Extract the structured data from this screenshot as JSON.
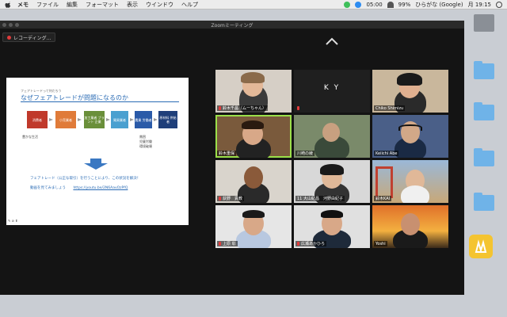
{
  "menubar": {
    "items": [
      "メモ",
      "ファイル",
      "編集",
      "フォーマット",
      "表示",
      "ウインドウ",
      "ヘルプ"
    ],
    "time_indicator": "05:00",
    "battery": "99%",
    "input_source": "ひらがな (Google)",
    "clock": "月 19:15"
  },
  "window": {
    "title": "Zoomミーティング",
    "recording_label": "レコーディング..."
  },
  "slide": {
    "kicker": "フェアトレードって何だろう",
    "title": "なぜフェアトレードが問題になるのか",
    "chain": [
      "消費者",
      "小売業者",
      "加工業者 ブラント 企業",
      "貿易業者",
      "農業 労働者",
      "原材料 供給者"
    ],
    "rich_label": "豊かな生活",
    "poor_labels": [
      "貧困",
      "児童労働",
      "環境破壊"
    ],
    "line1": "フェアトレード（公正な取引）を行うことにより、この状況を解決！",
    "line2_prefix": "動画を見てみましょう",
    "line2_url": "https://youtu.be/2N6AavOzPfQ"
  },
  "participants": [
    {
      "name": "鈴木千晶（ムーちゃん）",
      "muted": true
    },
    {
      "name": "",
      "initials": "K Y",
      "muted": true
    },
    {
      "name": "Chiko Shimizu",
      "muted": false
    },
    {
      "name": "鈴木重保",
      "muted": false,
      "active": true
    },
    {
      "name": "川崎の綾",
      "muted": false
    },
    {
      "name": "Keiichi Abe",
      "muted": false
    },
    {
      "name": "荻野　貢教",
      "muted": true
    },
    {
      "name": "11 大山紀昌　河野由紀子",
      "muted": false
    },
    {
      "name": "鈴木KAI",
      "muted": false
    },
    {
      "name": "上原 彰",
      "muted": true
    },
    {
      "name": "広瀬あかひろ",
      "muted": true
    },
    {
      "name": "Yoshi",
      "muted": false
    }
  ],
  "colors": {
    "menubar_bg": "#ececec",
    "window_bg": "#141414",
    "active_speaker": "#9be04a",
    "slide_title": "#2b6cb5",
    "chain_1": "#c0392b",
    "chain_2": "#e07b39",
    "chain_3": "#6a8f3a",
    "chain_4": "#4aa0d0",
    "chain_5": "#2a5aa8",
    "chain_6": "#1f3f7a"
  }
}
